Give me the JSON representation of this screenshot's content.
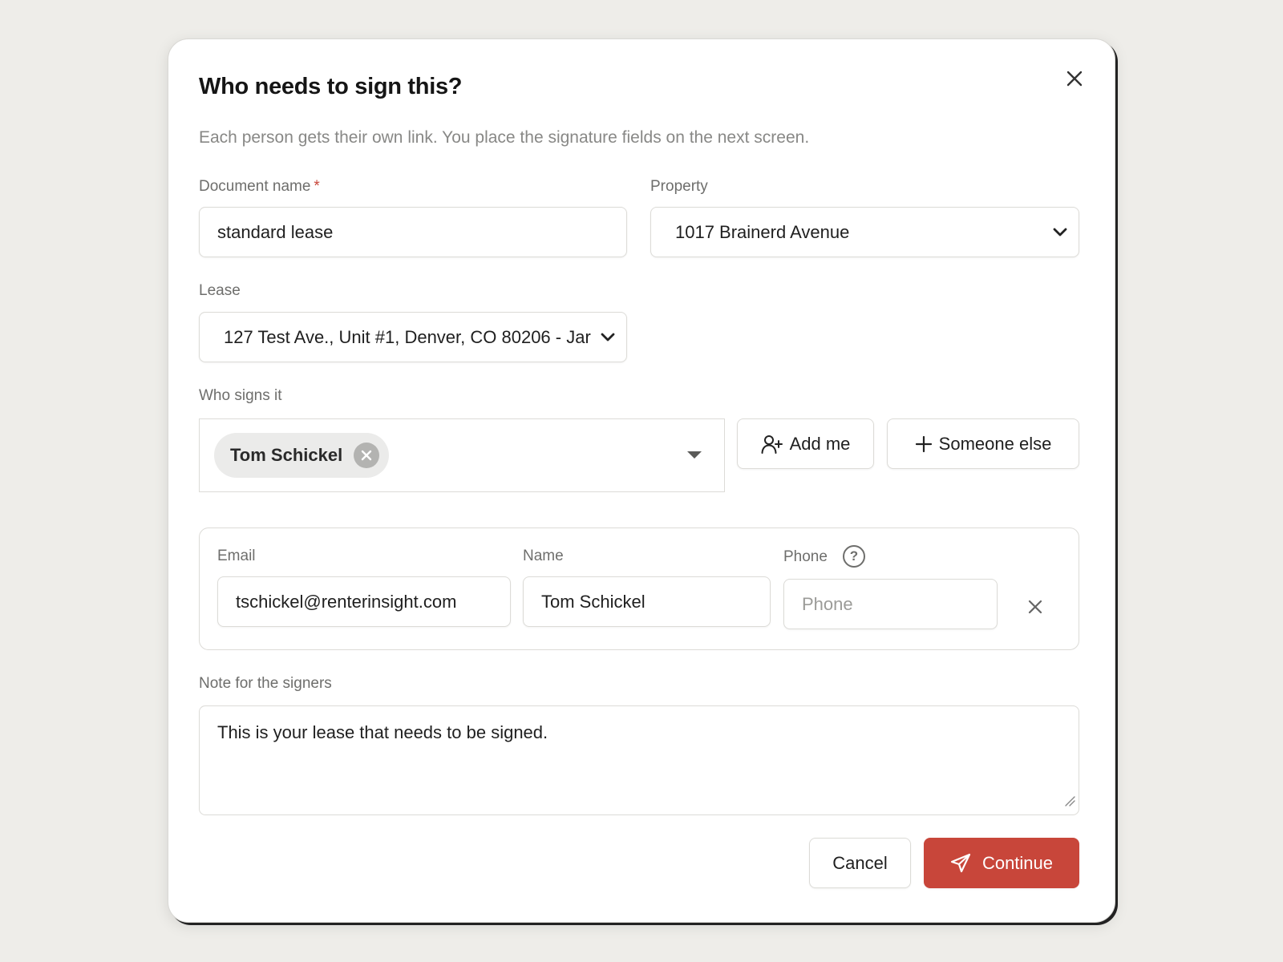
{
  "dialog": {
    "title": "Who needs to sign this?",
    "subtitle": "Each person gets their own link. You place the signature fields on the next screen."
  },
  "document_name": {
    "label": "Document name",
    "required_mark": "*",
    "value": "standard lease"
  },
  "property": {
    "label": "Property",
    "selected": "1017 Brainerd Avenue"
  },
  "lease": {
    "label": "Lease",
    "selected": "127 Test Ave., Unit #1, Denver, CO 80206 - Jar"
  },
  "signers": {
    "label": "Who signs it",
    "chips": [
      "Tom Schickel"
    ],
    "add_me_label": "Add me",
    "someone_else_label": "Someone else"
  },
  "signer_row": {
    "email_label": "Email",
    "email_value": "tschickel@renterinsight.com",
    "name_label": "Name",
    "name_value": "Tom Schickel",
    "phone_label": "Phone",
    "phone_placeholder": "Phone",
    "help_glyph": "?"
  },
  "note": {
    "label": "Note for the signers",
    "value": "This is your lease that needs to be signed."
  },
  "actions": {
    "cancel_label": "Cancel",
    "continue_label": "Continue"
  },
  "colors": {
    "primary": "#c8463a",
    "background": "#eeede9",
    "border": "#dcdbd7",
    "muted_text": "#888886"
  },
  "icons": {
    "close": "close-icon",
    "chevron": "chevron-down-icon",
    "chip_remove": "remove-circle-icon",
    "add_user": "user-plus-icon",
    "plus": "plus-icon",
    "help": "question-circle-icon",
    "remove_row": "close-icon",
    "send": "send-icon",
    "resize": "resize-handle-icon"
  }
}
